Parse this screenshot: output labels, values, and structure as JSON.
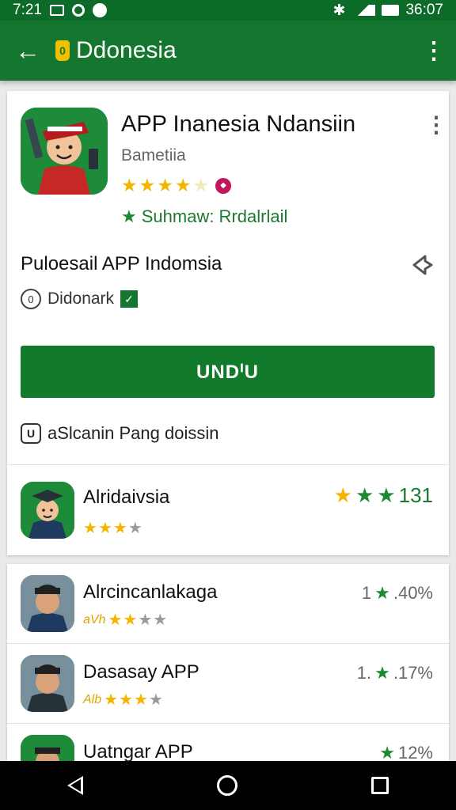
{
  "status_bar": {
    "time_left": "7:21",
    "time_right": "36:07"
  },
  "app_bar": {
    "back_glyph": "←",
    "logo_glyph": "0",
    "title": "Ddonesia",
    "more_glyph": "⋮"
  },
  "app": {
    "name": "APP Inanesia Ndansiin",
    "developer": "Bametiia",
    "rating_stars": 4,
    "rank_text": "Suhmaw:  Rrdalrlail",
    "more_glyph": "⋮"
  },
  "description": {
    "title": "Puloesail APP Indomsia",
    "sub_label": "Didonark",
    "sub_icon": "0",
    "check_glyph": "✓"
  },
  "install_button": {
    "label": "UNDᑊU"
  },
  "info": {
    "text": "aSlcanin Pang doissin",
    "icon": "U"
  },
  "featured": {
    "name": "Alridaivsia",
    "stars": 3,
    "score": "131"
  },
  "recommendations": [
    {
      "name": "Alrcincanlakaga",
      "prefix": "aVh",
      "stars": 2,
      "score_prefix": "1",
      "score": ".40%"
    },
    {
      "name": "Dasasay APP",
      "prefix": "Alb",
      "stars": 3,
      "score_prefix": "1.",
      "score": ".17%"
    },
    {
      "name": "Uatngar APP",
      "prefix": "",
      "stars": 0,
      "score_prefix": "",
      "score": "12%"
    }
  ],
  "colors": {
    "primary": "#15772f",
    "status_bar": "#0d6b2a",
    "star": "#f4b400",
    "accent_green": "#1a8a33"
  },
  "icons": [
    "back-arrow-icon",
    "app-logo-icon",
    "overflow-menu-icon",
    "share-icon",
    "copyright-icon",
    "verified-check-icon",
    "info-box-icon",
    "star-icon",
    "nav-back-icon",
    "nav-home-icon",
    "nav-recent-icon"
  ]
}
